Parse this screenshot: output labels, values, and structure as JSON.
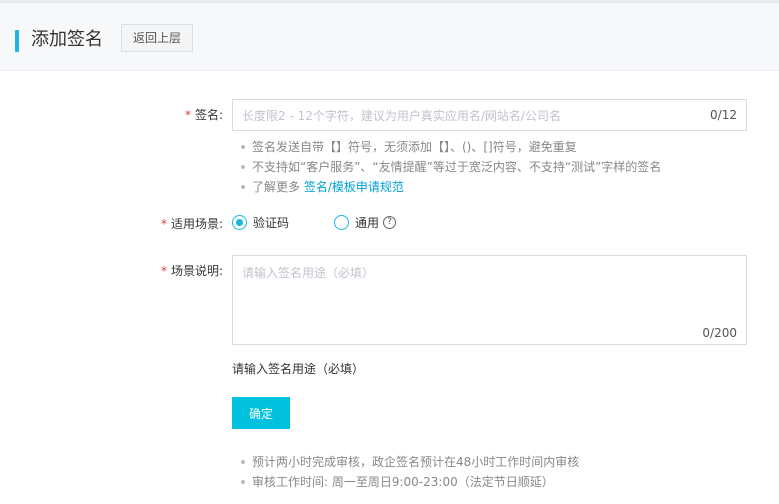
{
  "header": {
    "title": "添加签名",
    "back_label": "返回上层"
  },
  "form": {
    "required_mark": "*",
    "signature": {
      "label": "签名:",
      "placeholder": "长度限2 - 12个字符，建议为用户真实应用名/网站名/公司名",
      "value": "",
      "counter": "0/12"
    },
    "signature_tips": [
      "签名发送自带【】符号，无须添加【】、()、[]符号，避免重复",
      "不支持如“客户服务”、“友情提醒”等过于宽泛内容、不支持“测试”字样的签名"
    ],
    "learn_more": {
      "prefix": "了解更多",
      "link": "签名/模板申请规范"
    },
    "scenario": {
      "label": "适用场景:",
      "options": [
        {
          "label": "验证码",
          "checked": true
        },
        {
          "label": "通用",
          "checked": false
        }
      ],
      "help_icon": "question-circle-icon"
    },
    "description": {
      "label": "场景说明:",
      "placeholder": "请输入签名用途（必填）",
      "value": "",
      "counter": "0/200",
      "error": "请输入签名用途（必填）"
    },
    "submit_label": "确定",
    "footer_tips": [
      "预计两小时完成审核，政企签名预计在48小时工作时间内审核",
      "审核工作时间: 周一至周日9:00-23:00（法定节日顺延）"
    ]
  },
  "colors": {
    "accent": "#1ab6e8",
    "primary_button": "#00c1de",
    "required": "#e0403a",
    "link": "#00a3d9"
  }
}
